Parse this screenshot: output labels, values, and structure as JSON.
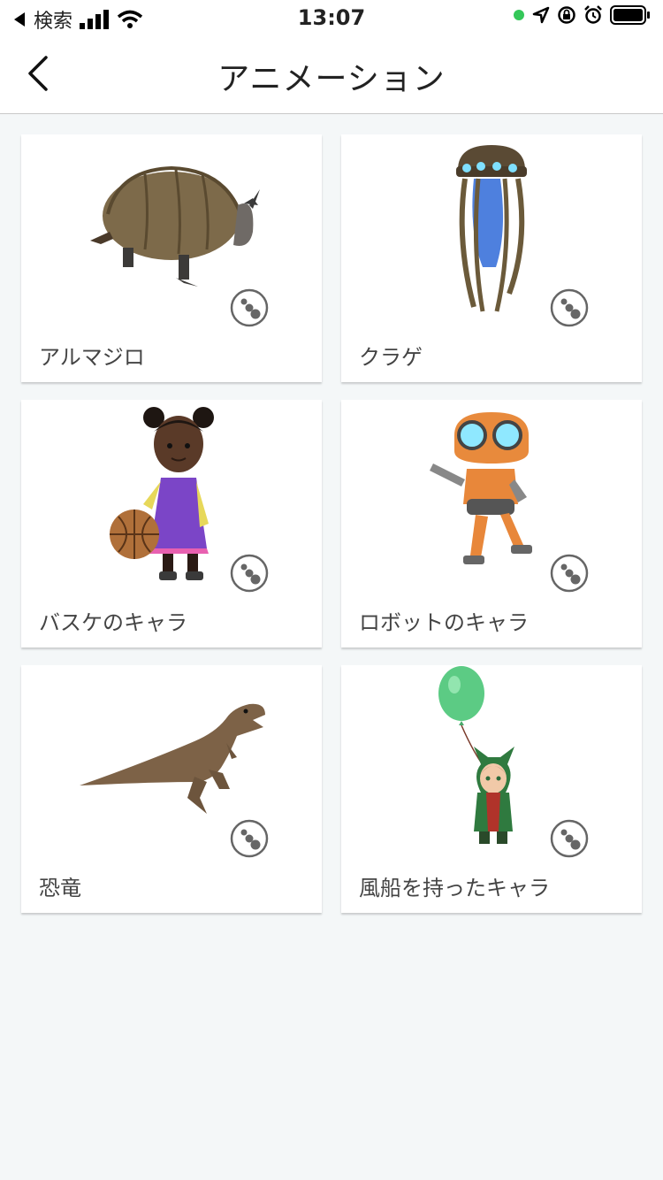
{
  "status": {
    "back_app": "検索",
    "time": "13:07"
  },
  "nav": {
    "title": "アニメーション"
  },
  "items": [
    {
      "label": "アルマジロ",
      "icon": "armadillo-image"
    },
    {
      "label": "クラゲ",
      "icon": "jellyfish-image"
    },
    {
      "label": "バスケのキャラ",
      "icon": "basketball-girl-image"
    },
    {
      "label": "ロボットのキャラ",
      "icon": "robot-image"
    },
    {
      "label": "恐竜",
      "icon": "dinosaur-image"
    },
    {
      "label": "風船を持ったキャラ",
      "icon": "balloon-character-image"
    }
  ],
  "colors": {
    "background": "#f4f7f8",
    "card": "#ffffff",
    "icon": "#666666",
    "accent_green": "#34c759"
  }
}
